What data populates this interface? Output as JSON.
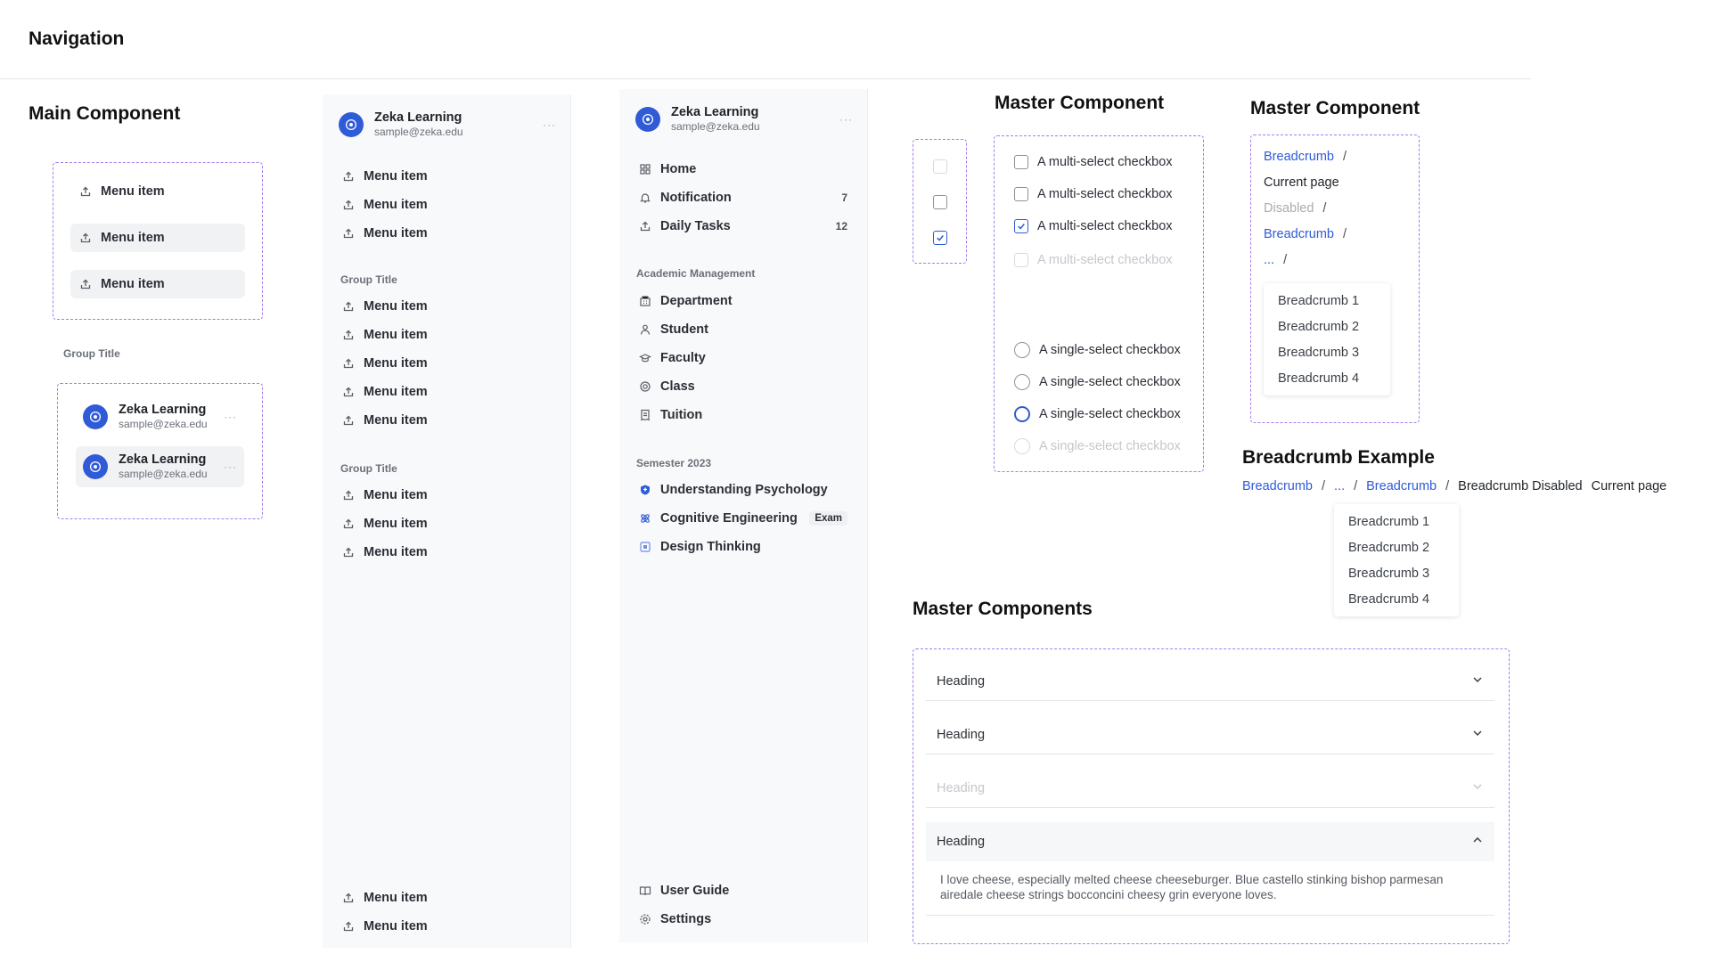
{
  "page": {
    "title": "Navigation"
  },
  "colors": {
    "accent": "#2f5bd7",
    "dashed_border": "#a37cf0",
    "panel_bg": "#f8f9fa"
  },
  "main_component": {
    "title": "Main Component",
    "menu_items": [
      {
        "label": "Menu item",
        "icon": "upload-icon"
      },
      {
        "label": "Menu item",
        "icon": "upload-icon"
      },
      {
        "label": "Menu item",
        "icon": "upload-icon"
      }
    ],
    "group_title": "Group Title",
    "user_cards": [
      {
        "name": "Zeka Learning",
        "email": "sample@zeka.edu",
        "more": "···"
      },
      {
        "name": "Zeka Learning",
        "email": "sample@zeka.edu",
        "more": "···"
      }
    ]
  },
  "sidebar_generic": {
    "user": {
      "name": "Zeka Learning",
      "email": "sample@zeka.edu",
      "more": "···"
    },
    "items_top": [
      "Menu item",
      "Menu item",
      "Menu item"
    ],
    "group1": {
      "title": "Group Title",
      "items": [
        "Menu item",
        "Menu item",
        "Menu item",
        "Menu item",
        "Menu item"
      ]
    },
    "group2": {
      "title": "Group Title",
      "items": [
        "Menu item",
        "Menu item",
        "Menu item"
      ]
    },
    "items_bottom": [
      "Menu item",
      "Menu item"
    ]
  },
  "sidebar_app": {
    "user": {
      "name": "Zeka Learning",
      "email": "sample@zeka.edu",
      "more": "···"
    },
    "items_top": [
      {
        "label": "Home",
        "icon": "grid-icon",
        "badge": ""
      },
      {
        "label": "Notification",
        "icon": "bell-icon",
        "badge": "7"
      },
      {
        "label": "Daily Tasks",
        "icon": "upload-icon",
        "badge": "12"
      }
    ],
    "academic": {
      "title": "Academic Management",
      "items": [
        {
          "label": "Department",
          "icon": "building-icon"
        },
        {
          "label": "Student",
          "icon": "user-icon"
        },
        {
          "label": "Faculty",
          "icon": "graduation-cap-icon"
        },
        {
          "label": "Class",
          "icon": "target-icon"
        },
        {
          "label": "Tuition",
          "icon": "receipt-icon"
        }
      ]
    },
    "semester": {
      "title": "Semester 2023",
      "items": [
        {
          "label": "Understanding Psychology",
          "icon": "shield-plus-icon",
          "tag": ""
        },
        {
          "label": "Cognitive Engineering",
          "icon": "atom-icon",
          "tag": "Exam"
        },
        {
          "label": "Design Thinking",
          "icon": "square-icon",
          "tag": ""
        }
      ]
    },
    "items_bottom": [
      {
        "label": "User Guide",
        "icon": "book-icon"
      },
      {
        "label": "Settings",
        "icon": "gear-icon"
      }
    ]
  },
  "checkbox_component": {
    "title": "Master Component",
    "multi": [
      {
        "label": "A multi-select checkbox",
        "state": "unchecked"
      },
      {
        "label": "A multi-select checkbox",
        "state": "unchecked"
      },
      {
        "label": "A multi-select checkbox",
        "state": "checked"
      },
      {
        "label": "A multi-select checkbox",
        "state": "disabled"
      }
    ],
    "single": [
      {
        "label": "A single-select checkbox",
        "state": "unchecked"
      },
      {
        "label": "A single-select checkbox",
        "state": "unchecked"
      },
      {
        "label": "A single-select checkbox",
        "state": "checked"
      },
      {
        "label": "A single-select checkbox",
        "state": "disabled"
      }
    ]
  },
  "breadcrumb_component": {
    "title": "Master Component",
    "rows": [
      {
        "text": "Breadcrumb",
        "sep": "/",
        "style": "link"
      },
      {
        "text": "Current page",
        "sep": "",
        "style": "current"
      },
      {
        "text": "Disabled",
        "sep": "/",
        "style": "disabled"
      },
      {
        "text": "Breadcrumb",
        "sep": "/",
        "style": "link"
      },
      {
        "text": "...",
        "sep": "/",
        "style": "link"
      }
    ],
    "dropdown": [
      "Breadcrumb 1",
      "Breadcrumb 2",
      "Breadcrumb 3",
      "Breadcrumb 4"
    ]
  },
  "breadcrumb_example": {
    "title": "Breadcrumb Example",
    "trail": [
      {
        "text": "Breadcrumb",
        "style": "link"
      },
      {
        "text": "/",
        "style": "sep"
      },
      {
        "text": "...",
        "style": "link"
      },
      {
        "text": "/",
        "style": "sep"
      },
      {
        "text": "Breadcrumb",
        "style": "link"
      },
      {
        "text": "/",
        "style": "sep"
      },
      {
        "text": "Breadcrumb Disabled",
        "style": "plain"
      },
      {
        "text": "Current page",
        "style": "plain"
      }
    ],
    "dropdown": [
      "Breadcrumb 1",
      "Breadcrumb 2",
      "Breadcrumb 3",
      "Breadcrumb 4"
    ]
  },
  "accordion": {
    "title": "Master Components",
    "items": [
      {
        "heading": "Heading",
        "state": "collapsed"
      },
      {
        "heading": "Heading",
        "state": "collapsed"
      },
      {
        "heading": "Heading",
        "state": "disabled"
      },
      {
        "heading": "Heading",
        "state": "expanded",
        "body": "I love cheese, especially melted cheese cheeseburger. Blue castello stinking bishop parmesan airedale cheese strings bocconcini cheesy grin everyone loves."
      }
    ]
  }
}
